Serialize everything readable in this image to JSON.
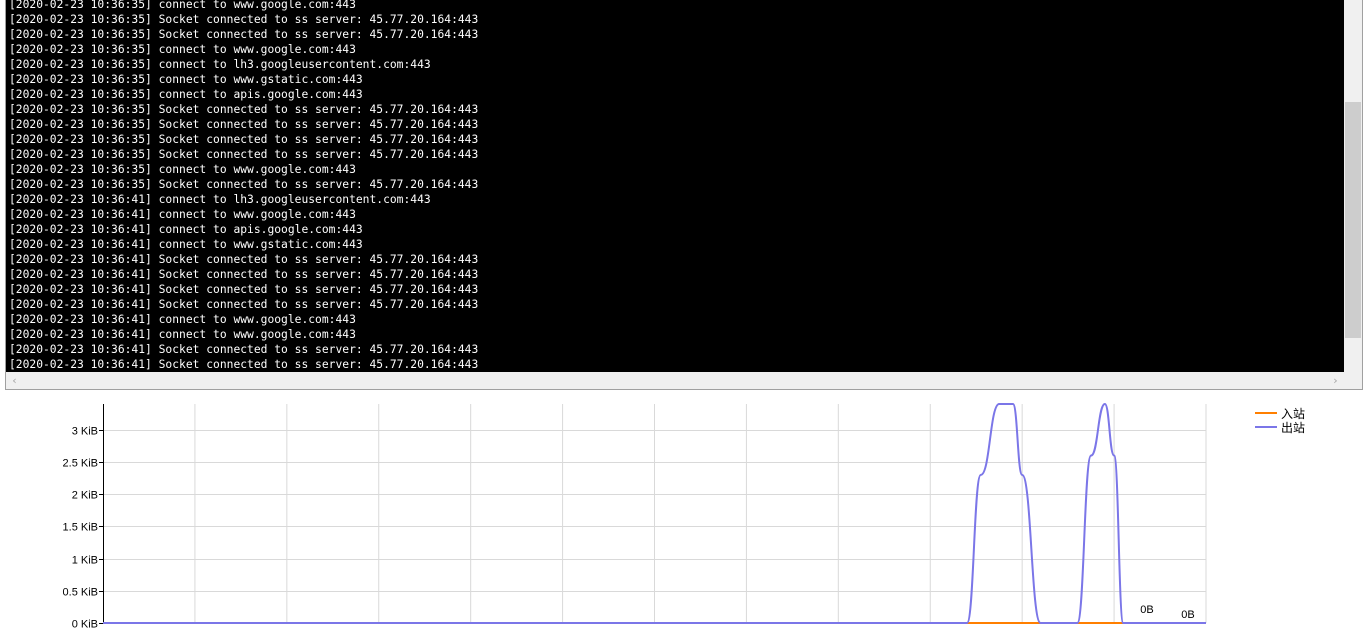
{
  "log": {
    "lines": [
      "[2020-02-23 10:36:35] connect to www.google.com:443",
      "[2020-02-23 10:36:35] Socket connected to ss server: 45.77.20.164:443",
      "[2020-02-23 10:36:35] Socket connected to ss server: 45.77.20.164:443",
      "[2020-02-23 10:36:35] connect to www.google.com:443",
      "[2020-02-23 10:36:35] connect to lh3.googleusercontent.com:443",
      "[2020-02-23 10:36:35] connect to www.gstatic.com:443",
      "[2020-02-23 10:36:35] connect to apis.google.com:443",
      "[2020-02-23 10:36:35] Socket connected to ss server: 45.77.20.164:443",
      "[2020-02-23 10:36:35] Socket connected to ss server: 45.77.20.164:443",
      "[2020-02-23 10:36:35] Socket connected to ss server: 45.77.20.164:443",
      "[2020-02-23 10:36:35] Socket connected to ss server: 45.77.20.164:443",
      "[2020-02-23 10:36:35] connect to www.google.com:443",
      "[2020-02-23 10:36:35] Socket connected to ss server: 45.77.20.164:443",
      "[2020-02-23 10:36:41] connect to lh3.googleusercontent.com:443",
      "[2020-02-23 10:36:41] connect to www.google.com:443",
      "[2020-02-23 10:36:41] connect to apis.google.com:443",
      "[2020-02-23 10:36:41] connect to www.gstatic.com:443",
      "[2020-02-23 10:36:41] Socket connected to ss server: 45.77.20.164:443",
      "[2020-02-23 10:36:41] Socket connected to ss server: 45.77.20.164:443",
      "[2020-02-23 10:36:41] Socket connected to ss server: 45.77.20.164:443",
      "[2020-02-23 10:36:41] Socket connected to ss server: 45.77.20.164:443",
      "[2020-02-23 10:36:41] connect to www.google.com:443",
      "[2020-02-23 10:36:41] connect to www.google.com:443",
      "[2020-02-23 10:36:41] Socket connected to ss server: 45.77.20.164:443",
      "[2020-02-23 10:36:41] Socket connected to ss server: 45.77.20.164:443"
    ],
    "background": "#000000",
    "text_color": "#ffffff"
  },
  "scrollbars": {
    "vertical_icon": "scrollbar-thumb",
    "left_arrow": "‹",
    "right_arrow": "›"
  },
  "chart_data": {
    "type": "line",
    "ylim": [
      0,
      3.4
    ],
    "y_tick_values": [
      0,
      0.5,
      1,
      1.5,
      2,
      2.5,
      3
    ],
    "y_tick_labels": [
      "0 KiB",
      "0.5 KiB",
      "1 KiB",
      "1.5 KiB",
      "2 KiB",
      "2.5 KiB",
      "3 KiB"
    ],
    "x_divisions": 12,
    "grid": true,
    "legend_placement": "top-right",
    "series": [
      {
        "name": "入站",
        "color": "#ff7f00",
        "x": [
          0,
          1,
          2,
          3,
          4,
          5,
          6,
          7,
          8,
          9,
          10,
          11,
          12
        ],
        "values": [
          0,
          0,
          0,
          0,
          0,
          0,
          0,
          0,
          0,
          0,
          0,
          0,
          0
        ]
      },
      {
        "name": "出站",
        "color": "#7b76e8",
        "x": [
          0,
          1,
          2,
          3,
          4,
          5,
          6,
          7,
          8,
          9,
          9.4,
          9.55,
          9.75,
          9.9,
          10,
          10.2,
          10.5,
          10.6,
          10.75,
          10.9,
          11.0,
          11.1,
          12
        ],
        "values": [
          0,
          0,
          0,
          0,
          0,
          0,
          0,
          0,
          0,
          0,
          0,
          2.3,
          3.4,
          3.4,
          2.3,
          0,
          0,
          0,
          2.6,
          3.4,
          2.6,
          0,
          0
        ]
      }
    ],
    "end_labels": [
      "0B",
      "0B"
    ]
  }
}
